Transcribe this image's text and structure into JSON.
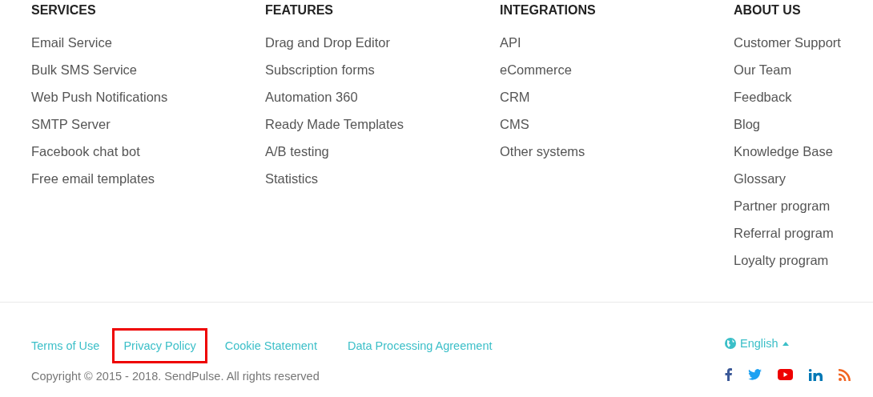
{
  "columns": [
    {
      "heading": "SERVICES",
      "links": [
        "Email Service",
        "Bulk SMS Service",
        "Web Push Notifications",
        "SMTP Server",
        "Facebook chat bot",
        "Free email templates"
      ]
    },
    {
      "heading": "FEATURES",
      "links": [
        "Drag and Drop Editor",
        "Subscription forms",
        "Automation 360",
        "Ready Made Templates",
        "A/B testing",
        "Statistics"
      ]
    },
    {
      "heading": "INTEGRATIONS",
      "links": [
        "API",
        "eCommerce",
        "CRM",
        "CMS",
        "Other systems"
      ]
    },
    {
      "heading": "ABOUT US",
      "links": [
        "Customer Support",
        "Our Team",
        "Feedback",
        "Blog",
        "Knowledge Base",
        "Glossary",
        "Partner program",
        "Referral program",
        "Loyalty program"
      ]
    }
  ],
  "legal_links": [
    {
      "label": "Terms of Use",
      "highlighted": false
    },
    {
      "label": "Privacy Policy",
      "highlighted": true
    },
    {
      "label": "Cookie Statement",
      "highlighted": false
    },
    {
      "label": "Data Processing Agreement",
      "highlighted": false
    }
  ],
  "copyright": "Copyright © 2015 - 2018. SendPulse. All rights reserved",
  "language": "English",
  "social": [
    {
      "kind": "facebook"
    },
    {
      "kind": "twitter"
    },
    {
      "kind": "youtube"
    },
    {
      "kind": "linkedin"
    },
    {
      "kind": "rss"
    }
  ]
}
